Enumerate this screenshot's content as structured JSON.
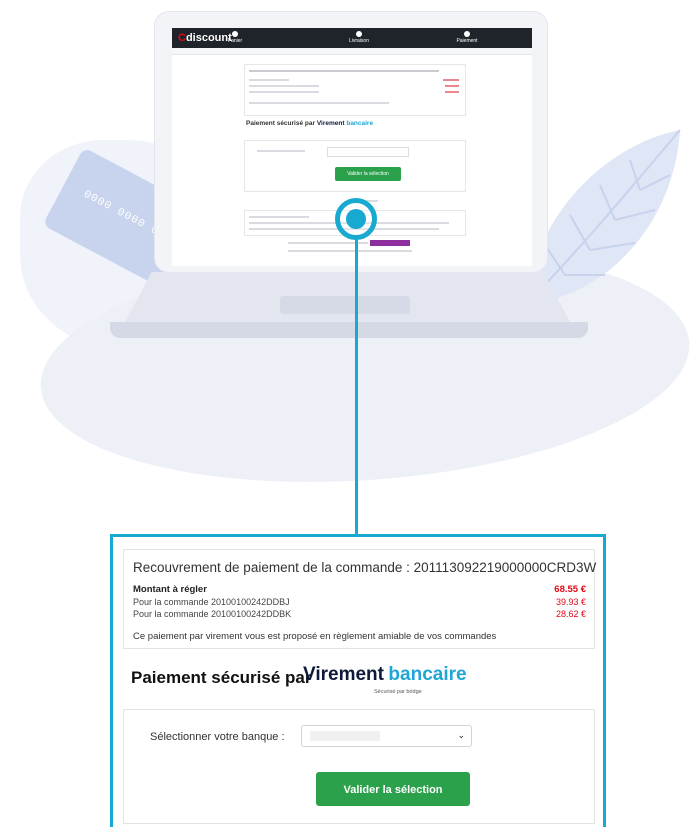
{
  "browser_mini": {
    "brand": "discount",
    "brand_initial": "C",
    "steps": [
      "Panier",
      "Livraison",
      "Paiement"
    ]
  },
  "background": {
    "card_number": "0000 0000 00"
  },
  "zoom": {
    "recap_title": "Recouvrement de paiement de la commande : 201113092219000000CRD3W",
    "amount_label": "Montant à régler",
    "amount_total": "68.55 €",
    "orders": [
      {
        "label": "Pour la commande 20100100242DDBJ",
        "amount": "39.93 €"
      },
      {
        "label": "Pour la commande 20100100242DDBK",
        "amount": "28.62 €"
      }
    ],
    "note": "Ce paiement par virement vous est proposé en règlement amiable de vos commandes",
    "secure_title": "Paiement sécurisé par",
    "brand_virement": "Virement",
    "brand_bancaire": "bancaire",
    "brand_sub": "Sécurisé par bridge",
    "bank_label": "Sélectionner votre banque :",
    "validate_label": "Valider la sélection"
  },
  "colors": {
    "accent": "#17a9cf",
    "green": "#2ba14b",
    "red": "#e30613"
  }
}
